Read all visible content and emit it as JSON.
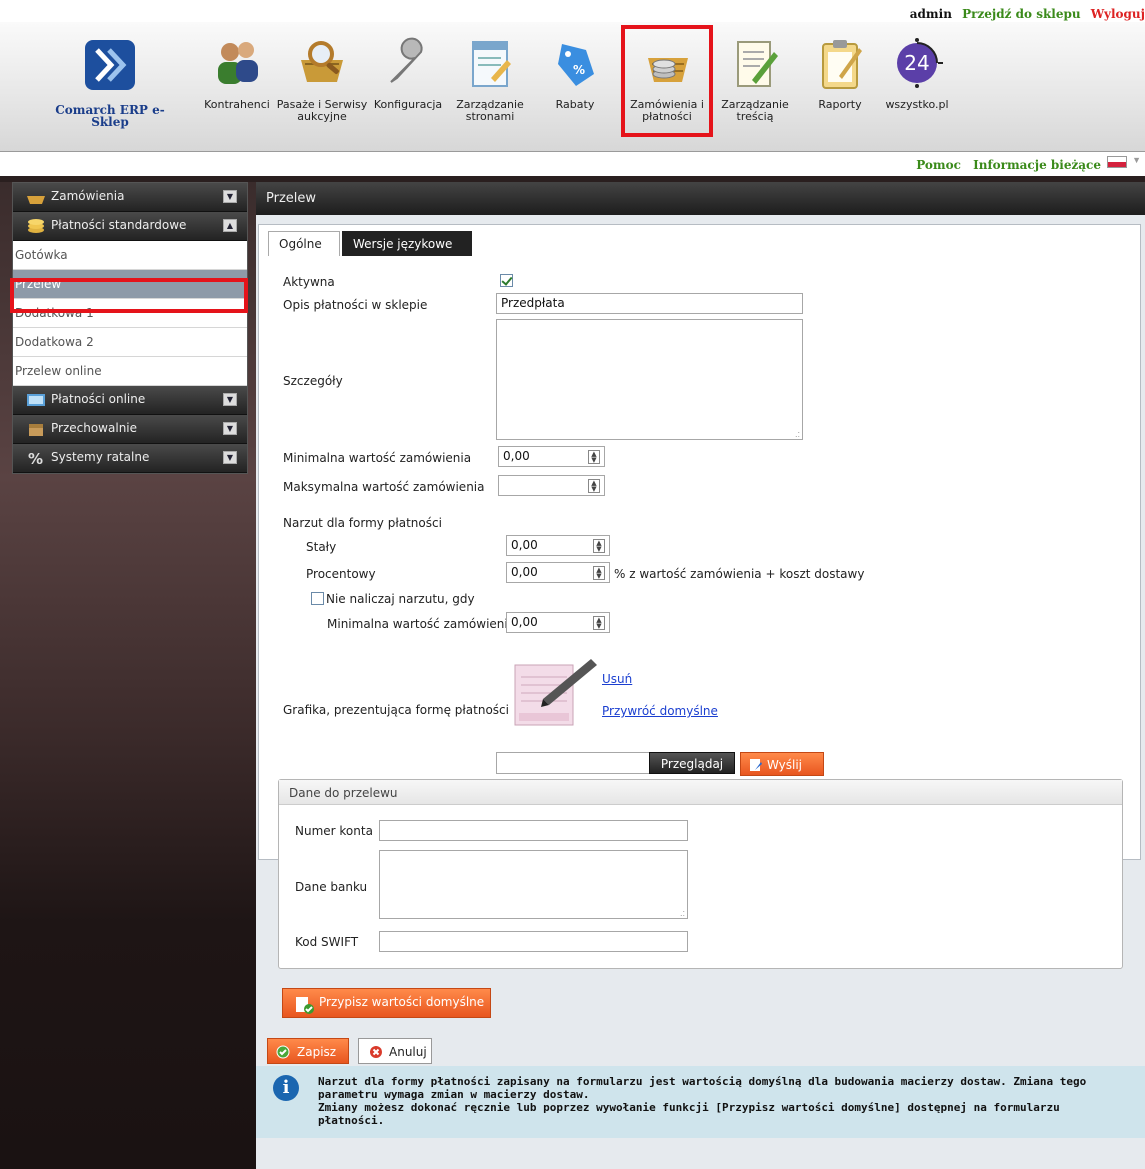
{
  "userbar": {
    "admin": "admin",
    "shop": "Przejdź do sklepu",
    "logout": "Wyloguj"
  },
  "ribbon": {
    "brand": "Comarch ERP e-Sklep",
    "items": [
      {
        "label1": "Kontrahenci",
        "label2": "",
        "icon": "people-icon"
      },
      {
        "label1": "Pasaże i Serwisy",
        "label2": "aukcyjne",
        "icon": "magnifier-basket-icon"
      },
      {
        "label1": "Konfiguracja",
        "label2": "",
        "icon": "wrench-icon"
      },
      {
        "label1": "Zarządzanie",
        "label2": "stronami",
        "icon": "page-edit-icon"
      },
      {
        "label1": "Rabaty",
        "label2": "",
        "icon": "price-tag-icon"
      },
      {
        "label1": "Zamówienia i",
        "label2": "płatności",
        "icon": "basket-coins-icon"
      },
      {
        "label1": "Zarządzanie",
        "label2": "treścią",
        "icon": "document-pencil-icon"
      },
      {
        "label1": "Raporty",
        "label2": "",
        "icon": "clipboard-icon"
      },
      {
        "label1": "wszystko.pl",
        "label2": "",
        "icon": "24-badge-icon",
        "badge": "24"
      }
    ]
  },
  "helpbar": {
    "help": "Pomoc",
    "news": "Informacje bieżące"
  },
  "sidebar": {
    "sections": [
      {
        "label": "Zamówienia"
      },
      {
        "label": "Płatności standardowe"
      },
      {
        "label": "Płatności online"
      },
      {
        "label": "Przechowalnie"
      },
      {
        "label": "Systemy ratalne"
      }
    ],
    "items": [
      "Gotówka",
      "Przelew",
      "Dodatkowa 1",
      "Dodatkowa 2",
      "Przelew online"
    ]
  },
  "main": {
    "title": "Przelew",
    "tabs": [
      "Ogólne",
      "Wersje językowe"
    ],
    "form": {
      "active_label": "Aktywna",
      "desc_label": "Opis płatności w sklepie",
      "desc_value": "Przedpłata",
      "details_label": "Szczegóły",
      "min_label": "Minimalna wartość zamówienia",
      "min_value": "0,00",
      "max_label": "Maksymalna wartość zamówienia",
      "max_value": "",
      "surcharge_label": "Narzut dla formy płatności",
      "fixed_label": "Stały",
      "fixed_value": "0,00",
      "percent_label": "Procentowy",
      "percent_value": "0,00",
      "percent_suffix": "% z wartość zamówienia + koszt dostawy",
      "nocharge_label": "Nie naliczaj narzutu, gdy",
      "nocharge_min_label": "Minimalna wartość zamówienia",
      "nocharge_min_value": "0,00",
      "graphic_label": "Grafika, prezentująca formę płatności",
      "remove_link": "Usuń",
      "restore_link": "Przywróć domyślne",
      "browse_button": "Przeglądaj",
      "send_button": "Wyślij"
    },
    "bank": {
      "title": "Dane do przelewu",
      "account_label": "Numer konta",
      "bank_label": "Dane banku",
      "swift_label": "Kod SWIFT"
    },
    "assign_button": "Przypisz wartości domyślne",
    "save_button": "Zapisz",
    "cancel_button": "Anuluj",
    "info": {
      "line1": "Narzut dla formy płatności zapisany na formularzu jest wartością domyślną dla budowania macierzy dostaw. Zmiana tego",
      "line2": "parametru wymaga zmian w macierzy dostaw.",
      "line3": "Zmiany możesz dokonać ręcznie lub poprzez wywołanie funkcji [Przypisz wartości domyślne] dostępnej na formularzu",
      "line4": "płatności."
    }
  },
  "colors": {
    "accent_orange": "#e8561f",
    "highlight_red": "#e5131a",
    "link_blue": "#1b3fd0",
    "brand_blue": "#1a3d8a"
  }
}
